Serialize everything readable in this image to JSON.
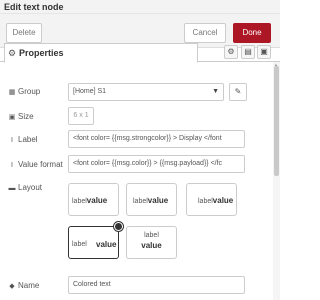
{
  "window": {
    "title": "Edit text node"
  },
  "toolbar": {
    "delete_label": "Delete",
    "cancel_label": "Cancel",
    "done_label": "Done",
    "done_color": "#ad1625"
  },
  "tabs": {
    "properties_label": "Properties"
  },
  "form": {
    "group": {
      "label": "Group",
      "value": "[Home] S1"
    },
    "size": {
      "label": "Size",
      "value": "6 x 1"
    },
    "label_field": {
      "label": "Label",
      "value": "<font color= {{msg.strongcolor}} > Display </font"
    },
    "value_format": {
      "label": "Value format",
      "value": "<font color= {{msg.color}} > {{msg.payload}} </fc"
    },
    "layout": {
      "label": "Layout",
      "options": [
        {
          "label": "label",
          "value": "value"
        },
        {
          "label": "label",
          "value": "value"
        },
        {
          "label": "label",
          "value": "value"
        },
        {
          "label": "label",
          "value": "value"
        },
        {
          "label": "label",
          "value": "value"
        }
      ],
      "selected_index": 3
    },
    "name": {
      "label": "Name",
      "value": "Colored text"
    }
  }
}
